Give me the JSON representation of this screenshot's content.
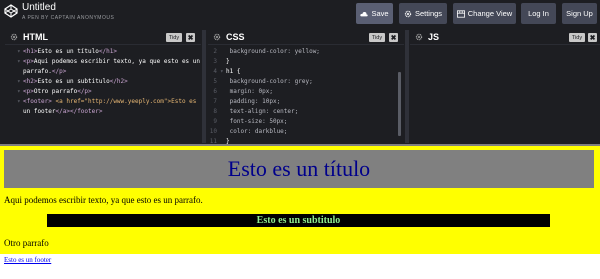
{
  "header": {
    "title": "Untitled",
    "subtitle": "A PEN BY CAPTAIN ANONYMOUS",
    "buttons": {
      "save": "Save",
      "settings": "Settings",
      "change_view": "Change View",
      "login": "Log In",
      "signup": "Sign Up"
    }
  },
  "panels": {
    "html": {
      "label": "HTML",
      "tidy": "Tidy",
      "close": "✖"
    },
    "css": {
      "label": "CSS",
      "tidy": "Tidy",
      "close": "✖"
    },
    "js": {
      "label": "JS",
      "tidy": "Tidy",
      "close": "✖"
    }
  },
  "html_code": [
    {
      "open": "<h1>",
      "text": "Esto es un título",
      "close": "</h1>"
    },
    {
      "open": "<p>",
      "text": "Aqui podemos escribir texto, ya que esto es un",
      "close": ""
    },
    {
      "open": "",
      "text": "parrafo.",
      "close": "</p>"
    },
    {
      "open": "<h2>",
      "text": "Esto es un subtitulo",
      "close": "</h2>"
    },
    {
      "open": "<p>",
      "text": "Otro parrafo",
      "close": "</p>"
    },
    {
      "open": "<footer>",
      "text": " <a href=\"http://www.yeeply.com\">Esto es",
      "close": ""
    },
    {
      "open": "",
      "text": "un footer",
      "close": "</a></footer>"
    }
  ],
  "css_code": [
    {
      "ln": "2",
      "text": "    background-color: yellow;"
    },
    {
      "ln": "3",
      "text": "}"
    },
    {
      "ln": "4",
      "text": "h1 {"
    },
    {
      "ln": "5",
      "text": "    background-color: grey;"
    },
    {
      "ln": "6",
      "text": "    margin: 0px;"
    },
    {
      "ln": "7",
      "text": "    padding: 10px;"
    },
    {
      "ln": "8",
      "text": "    text-align: center;"
    },
    {
      "ln": "9",
      "text": "    font-size: 50px;"
    },
    {
      "ln": "10",
      "text": "    color: darkblue;"
    },
    {
      "ln": "11",
      "text": "}"
    }
  ],
  "preview": {
    "h1": "Esto es un título",
    "p1": "Aqui podemos escribir texto, ya que esto es un parrafo.",
    "h2": "Esto es un subtitulo",
    "p2": "Otro parrafo",
    "footer_link": "Esto es un footer"
  },
  "colors": {
    "preview_bg": "#ffff00",
    "h1_bg": "#808080",
    "h1_color": "#00008b",
    "h2_bg": "#000000",
    "h2_color": "#90ee90"
  }
}
